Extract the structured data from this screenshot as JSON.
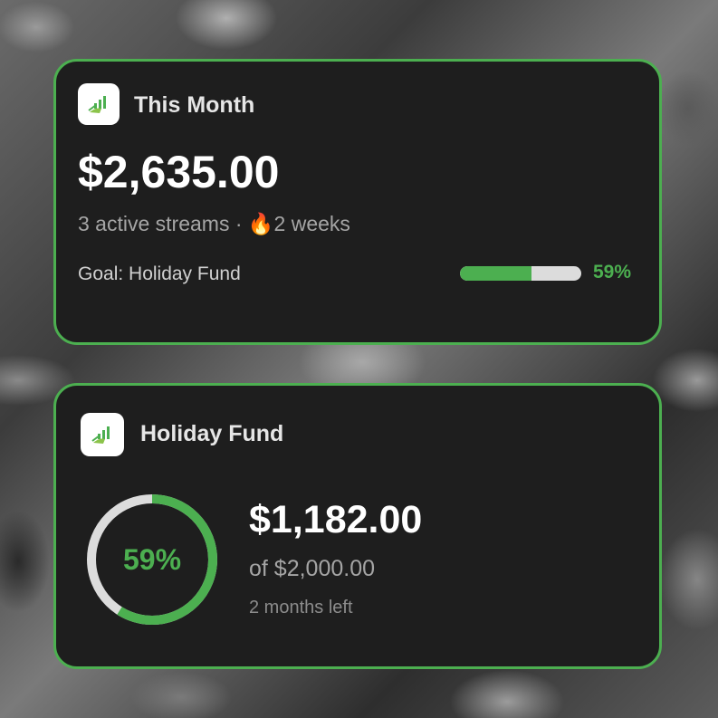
{
  "colors": {
    "accent": "#4caf50",
    "card_bg": "#1e1e1e",
    "track": "#dcdcdc"
  },
  "month_card": {
    "icon": "app-logo-icon",
    "title": "This Month",
    "amount": "$2,635.00",
    "streams_text": "3 active streams",
    "separator": "·",
    "streak_icon": "🔥",
    "streak_text": "2 weeks",
    "goal_label": "Goal: Holiday Fund",
    "goal_progress": 0.59,
    "goal_percent_text": "59%"
  },
  "fund_card": {
    "icon": "app-logo-icon",
    "title": "Holiday Fund",
    "progress": 0.59,
    "percent_text": "59%",
    "amount": "$1,182.00",
    "target_text": "of $2,000.00",
    "time_left": "2 months left"
  }
}
